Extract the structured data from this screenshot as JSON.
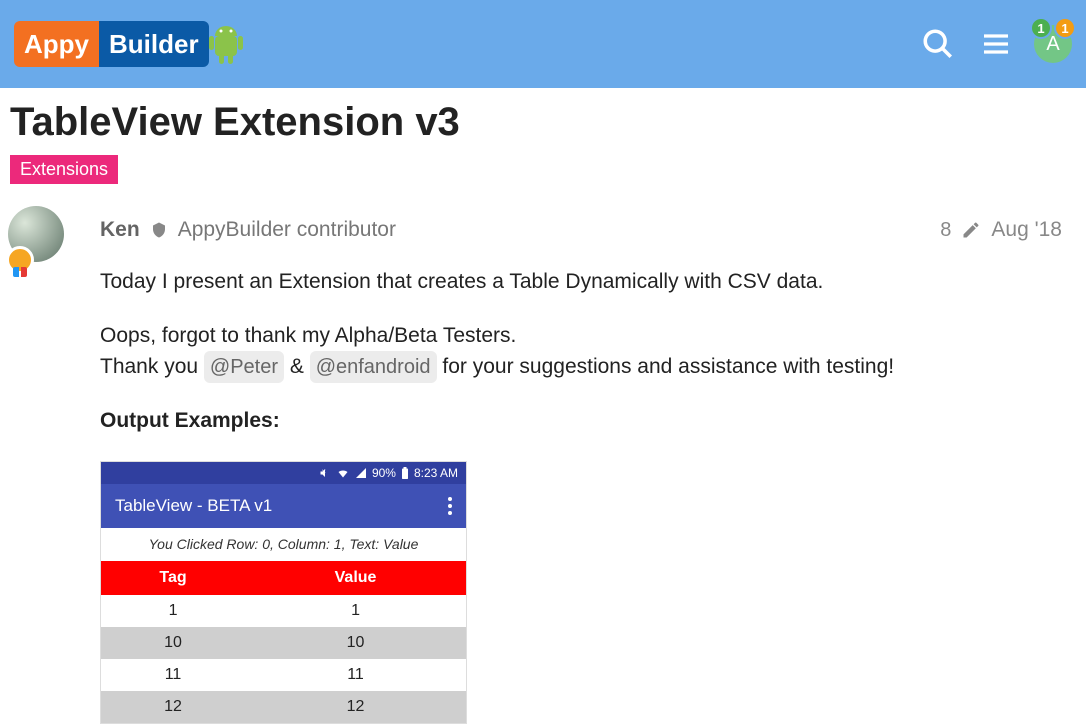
{
  "header": {
    "logo_left": "Appy",
    "logo_right": "Builder",
    "avatar_letter": "A",
    "badge_green": "1",
    "badge_orange": "1"
  },
  "topic": {
    "title": "TableView Extension v3",
    "category": "Extensions"
  },
  "post": {
    "author": "Ken",
    "user_title": "AppyBuilder contributor",
    "edits": "8",
    "date": "Aug '18",
    "p1": "Today I present an Extension that creates a Table Dynamically with CSV data.",
    "p2_a": "Oops, forgot to thank my Alpha/Beta Testers.",
    "p2_b": "Thank you ",
    "mention1": "@Peter",
    "amp": " & ",
    "mention2": "@enfandroid",
    "p2_c": " for your suggestions and assistance with testing!",
    "output_heading": "Output Examples:"
  },
  "phone": {
    "status_percent": "90%",
    "status_time": "8:23 AM",
    "app_title": "TableView - BETA v1",
    "click_info": "You Clicked Row: 0, Column: 1, Text: Value",
    "table": {
      "headers": [
        "Tag",
        "Value"
      ],
      "rows": [
        [
          "1",
          "1"
        ],
        [
          "10",
          "10"
        ],
        [
          "11",
          "11"
        ],
        [
          "12",
          "12"
        ]
      ]
    }
  }
}
